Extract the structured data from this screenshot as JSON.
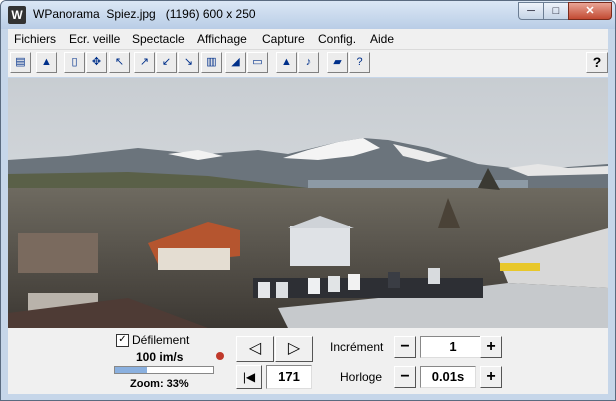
{
  "window": {
    "title": "WPanorama  Spiez.jpg   (1196) 600 x 250",
    "min_glyph": "─",
    "max_glyph": "□",
    "close_glyph": "✕",
    "app_icon_glyph": "W"
  },
  "menu": [
    "Fichiers",
    "Ecr. veille",
    "Spectacle",
    "Affichage",
    "Capture",
    "Config.",
    "Aide"
  ],
  "toolbar": {
    "help_label": "?"
  },
  "controls": {
    "scroll_checkbox_label": "Défilement",
    "scroll_checked": true,
    "check_glyph": "✓",
    "speed": "100 im/s",
    "zoom_label": "Zoom: 33%",
    "zoom_fraction": 0.33,
    "prev_glyph": "◁",
    "next_glyph": "▷",
    "first_glyph": "|◀",
    "position": "171",
    "increment_label": "Incrément",
    "increment_value": "1",
    "clock_label": "Horloge",
    "clock_value": "0.01s",
    "minus": "−",
    "plus": "+"
  }
}
